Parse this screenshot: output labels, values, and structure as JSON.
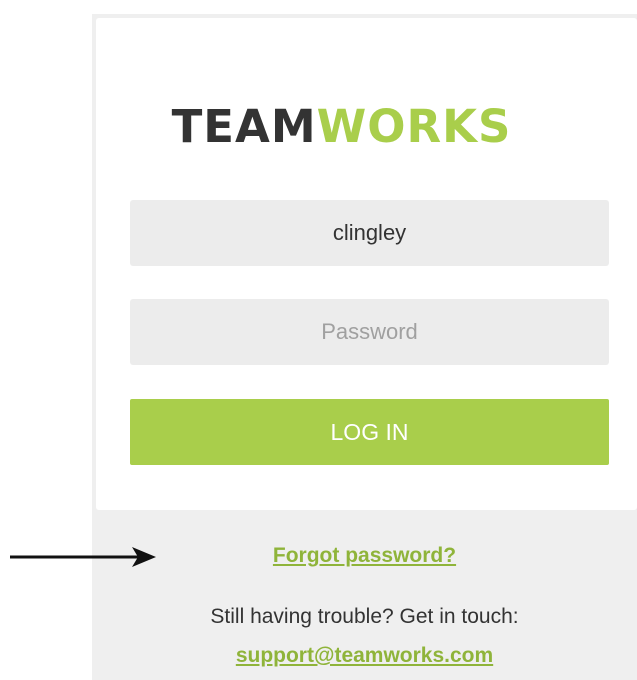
{
  "logo": {
    "part1": "TEAM",
    "part2": "WORKS",
    "color_dark": "#333333",
    "color_green": "#a9ce4b"
  },
  "login_form": {
    "username_value": "clingley",
    "password_placeholder": "Password",
    "login_button_label": "LOG IN"
  },
  "help": {
    "forgot_password_label": "Forgot password?",
    "trouble_text": "Still having trouble? Get in touch:",
    "support_email": "support@teamworks.com"
  },
  "annotation": {
    "arrow_icon": "right-arrow-icon"
  },
  "colors": {
    "accent": "#a9ce4b",
    "link": "#8fb43a",
    "panel_bg": "#efefef",
    "field_bg": "#ececec"
  }
}
